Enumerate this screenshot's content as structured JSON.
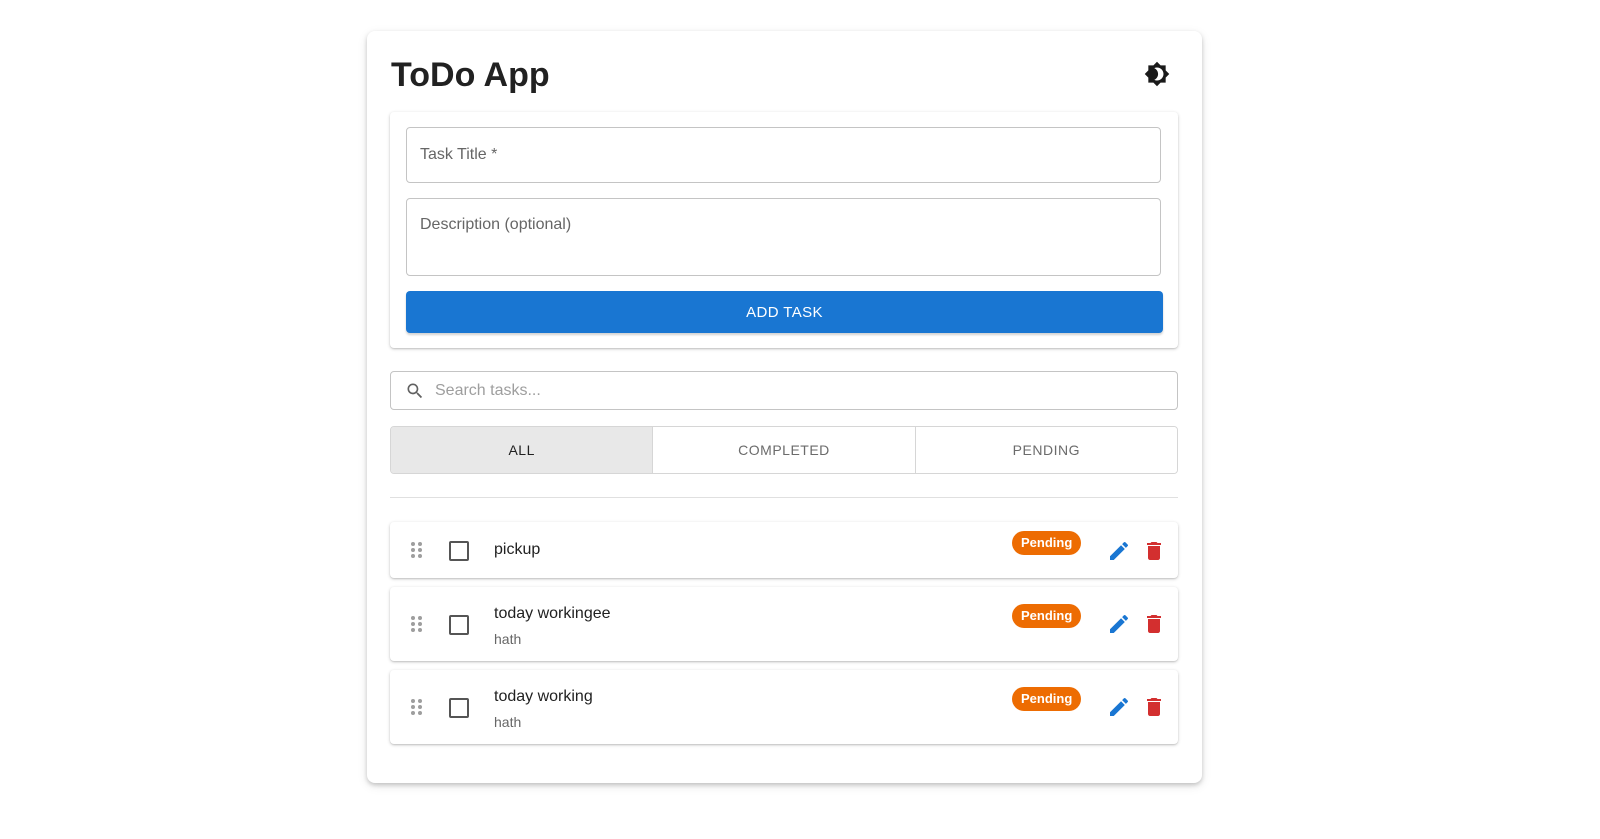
{
  "header": {
    "title": "ToDo App",
    "theme_toggle_icon": "brightness-icon"
  },
  "form": {
    "title_placeholder": "Task Title *",
    "description_placeholder": "Description (optional)",
    "add_label": "ADD TASK"
  },
  "search": {
    "placeholder": "Search tasks...",
    "icon": "search-icon"
  },
  "filters": [
    {
      "label": "ALL",
      "selected": true
    },
    {
      "label": "COMPLETED",
      "selected": false
    },
    {
      "label": "PENDING",
      "selected": false
    }
  ],
  "tasks": [
    {
      "title": "pickup",
      "description": "",
      "status": "Pending",
      "completed": false
    },
    {
      "title": "today workingee",
      "description": "hath",
      "status": "Pending",
      "completed": false
    },
    {
      "title": "today working",
      "description": "hath",
      "status": "Pending",
      "completed": false
    }
  ],
  "colors": {
    "primary": "#1976d2",
    "pending": "#ed6c02",
    "delete": "#d32f2f",
    "selected_filter_bg": "#e8e8e8"
  }
}
